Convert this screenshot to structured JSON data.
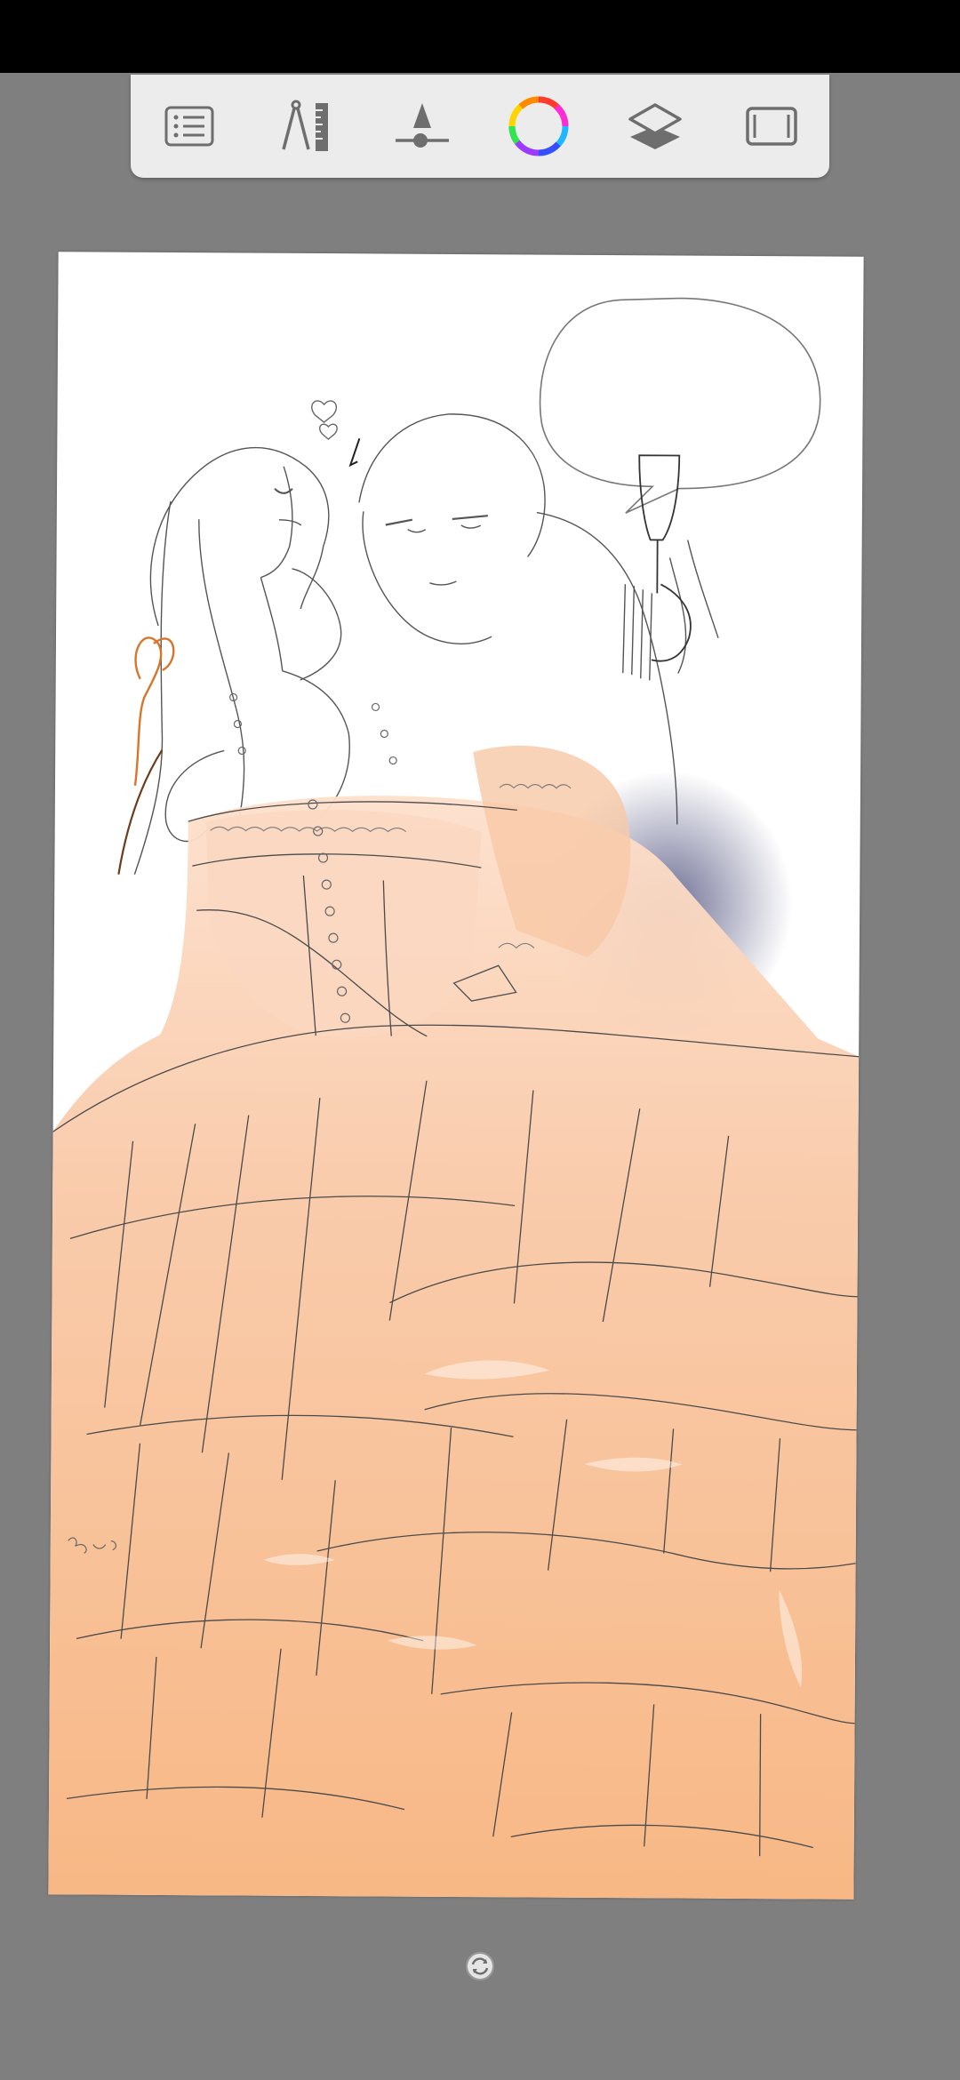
{
  "app": {
    "toolbar": {
      "items": [
        {
          "id": "menu",
          "icon": "list-menu-icon"
        },
        {
          "id": "ruler",
          "icon": "ruler-compass-icon"
        },
        {
          "id": "brush",
          "icon": "brush-size-icon"
        },
        {
          "id": "color",
          "icon": "color-wheel-icon"
        },
        {
          "id": "layers",
          "icon": "layers-icon"
        },
        {
          "id": "canvas",
          "icon": "canvas-frame-icon"
        }
      ]
    },
    "colors": {
      "statusBar": "#000000",
      "workspace": "#7f7f7f",
      "toolbar": "#ececec",
      "canvas": "#ffffff",
      "dressPeach": "#f8b27c",
      "shadowPurple": "#5d5a82",
      "ribbonOrange": "#d9752a"
    },
    "rotate_handle": {
      "icon": "rotate-canvas-icon"
    }
  }
}
